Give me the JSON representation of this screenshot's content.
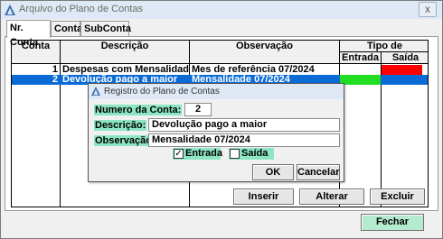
{
  "window": {
    "title": "Arquivo do Plano de Contas",
    "close_glyph": "x"
  },
  "tabs": [
    {
      "label": "Nr. Conta"
    },
    {
      "label": "Conta"
    },
    {
      "label": "SubConta"
    }
  ],
  "grid": {
    "columns": {
      "conta": "Conta",
      "descricao": "Descrição",
      "observacao": "Observação",
      "tipo_movimento": "Tipo de Movimento",
      "entrada": "Entrada",
      "saida": "Saída"
    },
    "rows": [
      {
        "conta": "1",
        "descricao": "Despesas com Mensalidade",
        "observacao": "Mes de referência 07/2024",
        "entrada": false,
        "saida": true,
        "selected": false
      },
      {
        "conta": "2",
        "descricao": "Devolução pago a maior",
        "observacao": "Mensalidade 07/2024",
        "entrada": true,
        "saida": false,
        "selected": true
      }
    ],
    "colors": {
      "entrada_on": "#22dd22",
      "saida_on": "#ff0000",
      "selection": "#0a6bd6"
    }
  },
  "buttons": {
    "inserir": "Inserir",
    "alterar": "Alterar",
    "excluir": "Excluir",
    "fechar": "Fechar"
  },
  "dialog": {
    "title": "Registro do Plano de Contas",
    "numero_label": "Numero da Conta:",
    "numero_value": "2",
    "descricao_label": "Descrição:",
    "descricao_value": "Devolução pago a maior",
    "observacao_label": "Observação:",
    "observacao_value": "Mensalidade 07/2024",
    "entrada_label": "Entrada",
    "entrada_checked": true,
    "saida_label": "Saída",
    "saida_checked": false,
    "check_glyph": "✓",
    "ok": "OK",
    "cancelar": "Cancelar"
  },
  "theme": {
    "label_bg": "#8ce6c4",
    "fechar_bg": "#b4ead0"
  }
}
